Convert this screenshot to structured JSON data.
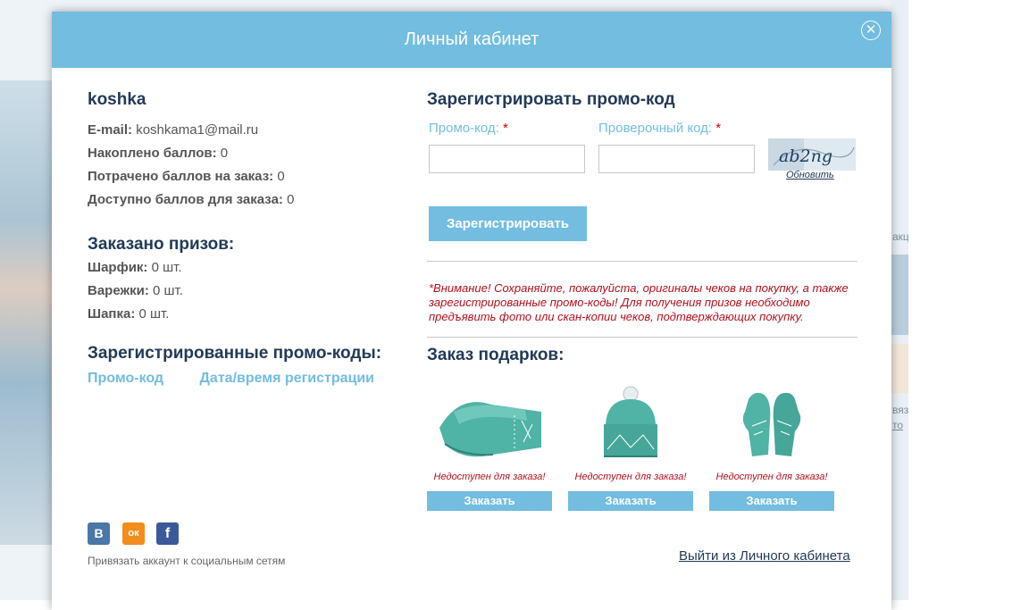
{
  "modal": {
    "title": "Личный кабинет",
    "close_glyph": "✕"
  },
  "user": {
    "name": "koshka",
    "rows": [
      {
        "label": "E-mail:",
        "value": "koshkama1@mail.ru"
      },
      {
        "label": "Накоплено баллов:",
        "value": "0"
      },
      {
        "label": "Потрачено баллов на заказ:",
        "value": "0"
      },
      {
        "label": "Доступно баллов для заказа:",
        "value": "0"
      }
    ]
  },
  "prizes": {
    "title": "Заказано призов:",
    "items": [
      {
        "label": "Шарфик:",
        "value": "0 шт."
      },
      {
        "label": "Варежки:",
        "value": "0 шт."
      },
      {
        "label": "Шапка:",
        "value": "0 шт."
      }
    ]
  },
  "registered_codes": {
    "title": "Зарегистрированные промо-коды:",
    "col_code": "Промо-код",
    "col_date": "Дата/время регистрации"
  },
  "register": {
    "title": "Зарегистрировать промо-код",
    "promo_label": "Промо-код:",
    "check_label": "Проверочный код:",
    "required_mark": "*",
    "promo_value": "",
    "check_value": "",
    "captcha_text": "ab2ng",
    "refresh_label": "Обновить",
    "submit_label": "Зарегистрировать"
  },
  "notice": "*Внимание! Сохраняйте, пожалуйста, оригиналы чеков на покупку, а также зарегистрированные промо-коды! Для получения призов необходимо предъявить фото или скан-копии чеков, подтверждающих покупку.",
  "gifts": {
    "title": "Заказ подарков:",
    "items": [
      {
        "icon": "scarf-icon",
        "status": "Недоступен для заказа!",
        "button": "Заказать"
      },
      {
        "icon": "hat-icon",
        "status": "Недоступен для заказа!",
        "button": "Заказать"
      },
      {
        "icon": "mittens-icon",
        "status": "Недоступен для заказа!",
        "button": "Заказать"
      }
    ]
  },
  "social": {
    "vk_glyph": "В",
    "ok_glyph": "ок",
    "fb_glyph": "f",
    "note": "Привязать аккаунт к социальным сетям"
  },
  "logout_label": "Выйти из Личного кабинета",
  "background": {
    "frag1": "акц",
    "frag2": "вяз",
    "frag3": "то"
  },
  "colors": {
    "header": "#72bde0",
    "accent_text": "#223a57",
    "warning": "#b0101c",
    "product": "#4fb3a5"
  }
}
